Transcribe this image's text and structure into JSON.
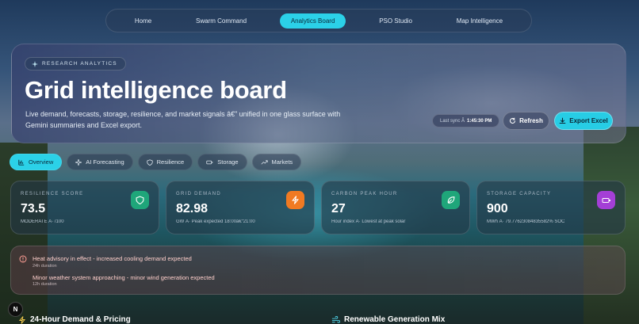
{
  "nav": {
    "items": [
      {
        "label": "Home"
      },
      {
        "label": "Swarm Command"
      },
      {
        "label": "Analytics Board",
        "active": true
      },
      {
        "label": "PSO Studio"
      },
      {
        "label": "Map Intelligence"
      }
    ]
  },
  "hero": {
    "chip": "RESEARCH ANALYTICS",
    "title": "Grid intelligence board",
    "subtitle": "Live demand, forecasts, storage, resilience, and market signals â€” unified in one glass surface with Gemini summaries and Excel export.",
    "sync_label": "Last sync Â",
    "sync_time": "1:45:30 PM",
    "refresh_label": "Refresh",
    "export_label": "Export Excel"
  },
  "tabs": [
    {
      "label": "Overview",
      "icon": "bar-chart-icon",
      "active": true
    },
    {
      "label": "AI Forecasting",
      "icon": "sparkle-icon"
    },
    {
      "label": "Resilience",
      "icon": "shield-icon"
    },
    {
      "label": "Storage",
      "icon": "battery-icon"
    },
    {
      "label": "Markets",
      "icon": "trend-icon"
    }
  ],
  "metrics": [
    {
      "label": "RESILIENCE SCORE",
      "value": "73.5",
      "foot": "MODERATE Â· /100",
      "icon": "shield-icon",
      "color": "#1fa67a"
    },
    {
      "label": "GRID DEMAND",
      "value": "82.98",
      "foot": "GW Â· Peak expected 18:00â€“21:00",
      "icon": "bolt-icon",
      "color": "#f07a22"
    },
    {
      "label": "CARBON PEAK HOUR",
      "value": "27",
      "foot": "Hour index Â· Lowest at peak solar",
      "icon": "leaf-icon",
      "color": "#1fa67a"
    },
    {
      "label": "STORAGE CAPACITY",
      "value": "900",
      "foot": "MWh Â· 79.77623084835582% SOC",
      "icon": "battery-icon",
      "color": "#a43fd6"
    }
  ],
  "alerts": [
    {
      "title": "Heat advisory in effect - increased cooling demand expected",
      "duration": "24h duration"
    },
    {
      "title": "Minor weather system approaching - minor wind generation expected",
      "duration": "12h duration"
    }
  ],
  "badge": "N",
  "sections": {
    "demand": "24-Hour Demand & Pricing",
    "renewable": "Renewable Generation Mix"
  }
}
